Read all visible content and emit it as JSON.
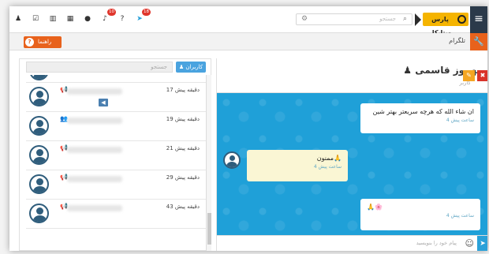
{
  "topbar": {
    "brand_label": "پارس ویتایکار",
    "search_placeholder": "جستجو",
    "icons": [
      {
        "name": "user-icon",
        "glyph": "♟"
      },
      {
        "name": "checkbox-icon",
        "glyph": "☑"
      },
      {
        "name": "bar-chart-icon",
        "glyph": "▥"
      },
      {
        "name": "calendar-icon",
        "glyph": "▦"
      },
      {
        "name": "circle-icon",
        "glyph": "●"
      },
      {
        "name": "bell-icon",
        "glyph": "♪"
      },
      {
        "name": "help-icon",
        "glyph": "?"
      },
      {
        "name": "telegram-icon",
        "glyph": "➤"
      }
    ],
    "bell_badge": "10",
    "telegram_badge": "18"
  },
  "subbar": {
    "title": "تلگرام",
    "help_label": "راهنما"
  },
  "contacts": {
    "search_placeholder": "جستجو",
    "users_button": "کاربران",
    "items": [
      {
        "time": "17 دقیقه پیش",
        "icon": "megaphone-icon",
        "glyph": "📢"
      },
      {
        "time": "19 دقیقه پیش",
        "icon": "group-icon",
        "glyph": "👥"
      },
      {
        "time": "21 دقیقه پیش",
        "icon": "megaphone-icon",
        "glyph": "📢"
      },
      {
        "time": "29 دقیقه پیش",
        "icon": "megaphone-icon",
        "glyph": "📢"
      },
      {
        "time": "43 دقیقه پیش",
        "icon": "megaphone-icon",
        "glyph": "📢"
      }
    ]
  },
  "chat": {
    "name": "بهروز قاسمی",
    "subtitle": "کاربر",
    "messages": [
      {
        "text": "ان شاء الله که هرچه سریعتر بهتر شین",
        "time": "4 ساعت پیش"
      },
      {
        "text": "ممنون🙏",
        "time": "4 ساعت پیش"
      },
      {
        "text": "🙏🌸",
        "time": "4 ساعت پیش"
      }
    ],
    "input_placeholder": "پیام خود را بنویسید"
  },
  "colors": {
    "accent_orange": "#e8621c",
    "brand_yellow": "#f5b400",
    "chat_blue": "#1fa0d8",
    "danger_red": "#d9342a",
    "edit_orange": "#f4a623"
  }
}
